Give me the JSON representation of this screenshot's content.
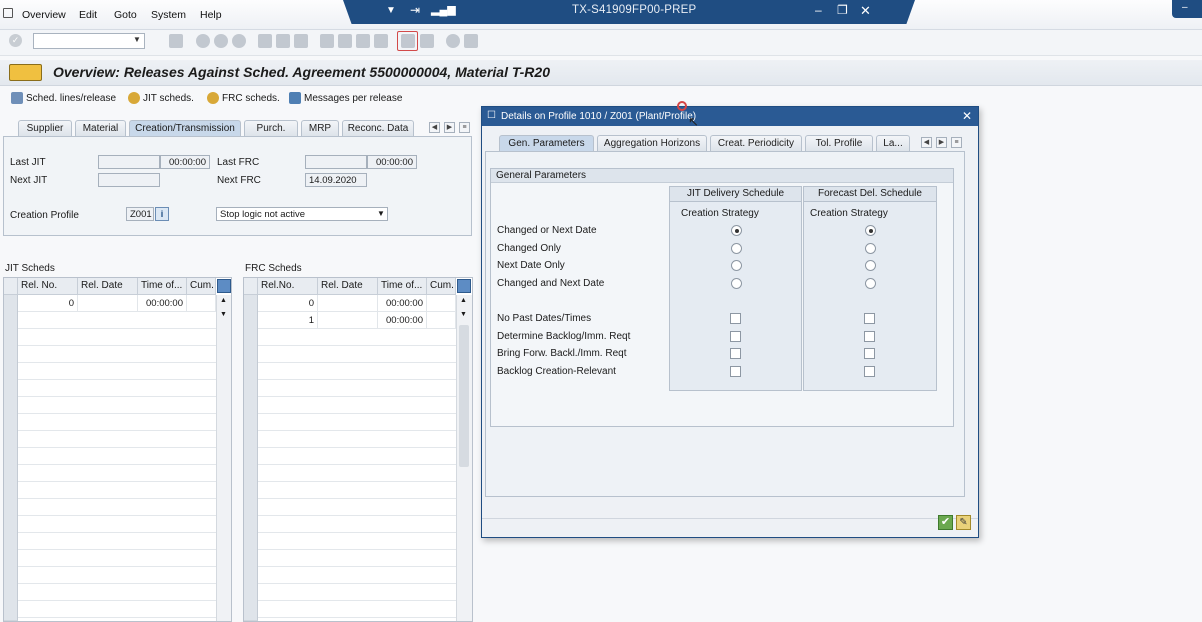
{
  "menu": {
    "items": [
      "Overview",
      "Edit",
      "Goto",
      "System",
      "Help"
    ]
  },
  "window": {
    "system_title": "TX-S41909FP00-PREP"
  },
  "page_title": "Overview: Releases Against Sched. Agreement 5500000004, Material T-R20",
  "app_toolbar": {
    "sched_lines": "Sched. lines/release",
    "jit_scheds": "JIT scheds.",
    "frc_scheds": "FRC scheds.",
    "messages": "Messages per release"
  },
  "main_tabs": [
    {
      "label": "Supplier"
    },
    {
      "label": "Material"
    },
    {
      "label": "Creation/Transmission"
    },
    {
      "label": "Purch."
    },
    {
      "label": "MRP"
    },
    {
      "label": "Reconc. Data"
    }
  ],
  "creation": {
    "last_jit_label": "Last JIT",
    "last_jit_time": "00:00:00",
    "next_jit_label": "Next JIT",
    "last_frc_label": "Last FRC",
    "last_frc_time": "00:00:00",
    "next_frc_label": "Next FRC",
    "next_frc_date": "14.09.2020",
    "creation_profile_label": "Creation Profile",
    "creation_profile_value": "Z001",
    "stop_logic": "Stop logic not active"
  },
  "jit_table": {
    "title": "JIT Scheds",
    "columns": [
      "Rel. No.",
      "Rel. Date",
      "Time of...",
      "Cum. R"
    ],
    "rows": [
      [
        "0",
        "",
        "00:00:00",
        ""
      ]
    ]
  },
  "frc_table": {
    "title": "FRC Scheds",
    "columns": [
      "Rel.No.",
      "Rel. Date",
      "Time of...",
      "Cum. R"
    ],
    "rows": [
      [
        "0",
        "",
        "00:00:00",
        ""
      ],
      [
        "1",
        "",
        "00:00:00",
        ""
      ]
    ]
  },
  "dialog": {
    "title": "Details on Profile 1010 / Z001 (Plant/Profile)",
    "tabs": [
      {
        "label": "Gen. Parameters"
      },
      {
        "label": "Aggregation Horizons"
      },
      {
        "label": "Creat. Periodicity"
      },
      {
        "label": "Tol. Profile"
      },
      {
        "label": "La..."
      }
    ],
    "section_title": "General Parameters",
    "col_jit": "JIT Delivery Schedule",
    "col_frc": "Forecast Del. Schedule",
    "sub_jit": "Creation Strategy",
    "sub_frc": "Creation Strategy",
    "strategies": [
      {
        "label": "Changed or Next Date",
        "jit": true,
        "frc": true
      },
      {
        "label": "Changed Only",
        "jit": false,
        "frc": false
      },
      {
        "label": "Next Date Only",
        "jit": false,
        "frc": false
      },
      {
        "label": "Changed and Next Date",
        "jit": false,
        "frc": false
      }
    ],
    "checks": [
      {
        "label": "No Past Dates/Times",
        "jit": false,
        "frc": false
      },
      {
        "label": "Determine Backlog/Imm. Reqt",
        "jit": false,
        "frc": false
      },
      {
        "label": "Bring Forw. Backl./Imm. Reqt",
        "jit": false,
        "frc": false
      },
      {
        "label": "Backlog Creation-Relevant",
        "jit": false,
        "frc": false
      }
    ]
  },
  "colors": {
    "brand_blue": "#1f4d82",
    "active_tab": "#c8d8ea",
    "confirm_green": "#6aa84f"
  }
}
